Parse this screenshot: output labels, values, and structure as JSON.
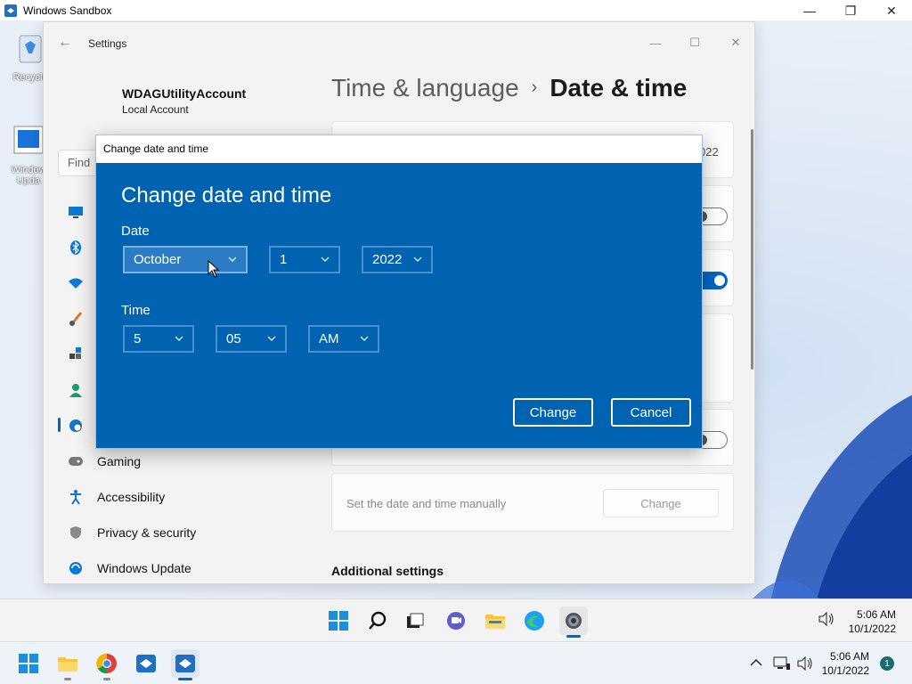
{
  "host_window": {
    "title": "Windows Sandbox",
    "minimize": "—",
    "maximize": "❐",
    "close": "✕"
  },
  "desktop": {
    "icons": [
      {
        "label": "Recycle"
      },
      {
        "label": "Window\nUpda"
      }
    ]
  },
  "settings": {
    "title": "Settings",
    "account": {
      "name": "WDAGUtilityAccount",
      "type": "Local Account"
    },
    "find_placeholder": "Find",
    "breadcrumb": {
      "parent": "Time & language",
      "separator": "›",
      "current": "Date & time"
    },
    "nav": [
      {
        "label": ""
      },
      {
        "label": ""
      },
      {
        "label": ""
      },
      {
        "label": ""
      },
      {
        "label": ""
      },
      {
        "label": ""
      },
      {
        "label": ""
      },
      {
        "label": "Gaming"
      },
      {
        "label": "Accessibility"
      },
      {
        "label": "Privacy & security"
      },
      {
        "label": "Windows Update"
      }
    ],
    "card_date_fragment": "022",
    "manual_row": {
      "label": "Set the date and time manually",
      "button": "Change"
    },
    "additional_settings": "Additional settings"
  },
  "dialog": {
    "window_title": "Change date and time",
    "heading": "Change date and time",
    "date_label": "Date",
    "month": "October",
    "day": "1",
    "year": "2022",
    "time_label": "Time",
    "hour": "5",
    "minute": "05",
    "ampm": "AM",
    "change_button": "Change",
    "cancel_button": "Cancel"
  },
  "inner_taskbar": {
    "time": "5:06 AM",
    "date": "10/1/2022"
  },
  "host_taskbar": {
    "time": "5:06 AM",
    "date": "10/1/2022",
    "notification_count": "1"
  },
  "colors": {
    "accent": "#0067c0",
    "dialog_bg": "#0063b1"
  }
}
